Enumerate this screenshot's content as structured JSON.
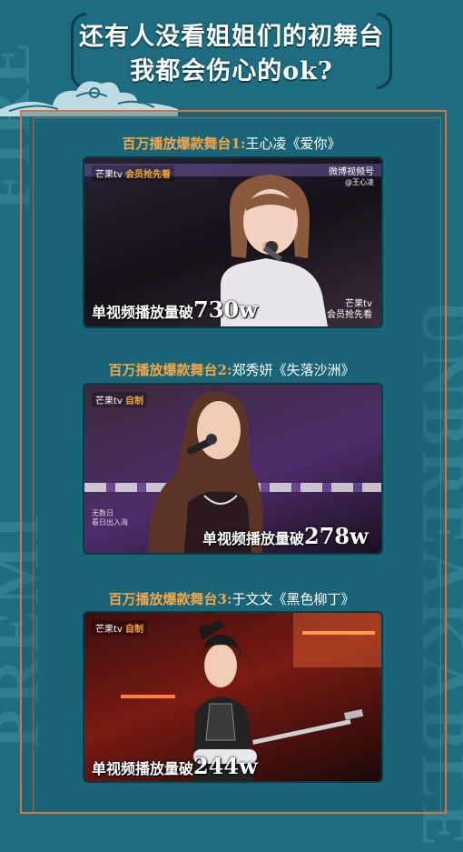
{
  "header": {
    "title_line1": "还有人没看姐姐们的初舞台",
    "title_line2": "我都会伤心的ok?"
  },
  "background": {
    "left_text_top": "FIRE",
    "left_text_bottom": "PREMI",
    "right_text": "UNBREAKABLE"
  },
  "stages": [
    {
      "caption_prefix": "百万播放爆款舞台1:",
      "caption_song": "王心凌《爱你》",
      "channel_logo": "芒果tv",
      "channel_badge": "会员抢先看",
      "weibo_label": "微博视频号",
      "weibo_handle": "@王心凌",
      "corner_logo_line1": "芒果tv",
      "corner_logo_line2": "会员抢先看",
      "views_prefix": "单视频播放量破",
      "views_value": "730w"
    },
    {
      "caption_prefix": "百万播放爆款舞台2:",
      "caption_song": "郑秀妍《失落沙洲》",
      "channel_logo": "芒果tv",
      "channel_badge": "自制",
      "subtitle_line1": "无数日",
      "subtitle_line2": "看日出入海",
      "views_prefix": "单视频播放量破",
      "views_value": "278w"
    },
    {
      "caption_prefix": "百万播放爆款舞台3:",
      "caption_song": "于文文《黑色柳丁》",
      "channel_logo": "芒果tv",
      "channel_badge": "自制",
      "views_prefix": "单视频播放量破",
      "views_value": "244w"
    }
  ],
  "colors": {
    "background": "#1e6c80",
    "accent_orange": "#f2a64a",
    "border_orange": "#d8743b",
    "title_white": "#ffffff"
  }
}
